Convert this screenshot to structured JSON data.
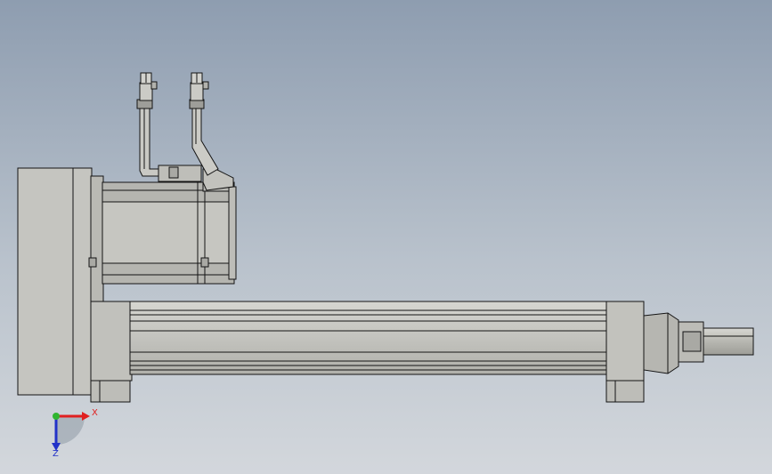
{
  "viewport": {
    "background_top": "#8e9db0",
    "background_bottom": "#d3d7dc"
  },
  "model": {
    "body_color": "#c4c4bf",
    "body_shade": "#a9a9a4",
    "edge_color": "#141414",
    "components": [
      "side-gearbox-housing",
      "servo-motor",
      "power-connector",
      "encoder-connector",
      "actuator-tube",
      "front-end-cap",
      "piston-rod"
    ]
  },
  "triad": {
    "x_label": "X",
    "z_label": "Z",
    "x_color": "#e02020",
    "y_color": "#2fb52f",
    "z_color": "#2232c8"
  }
}
